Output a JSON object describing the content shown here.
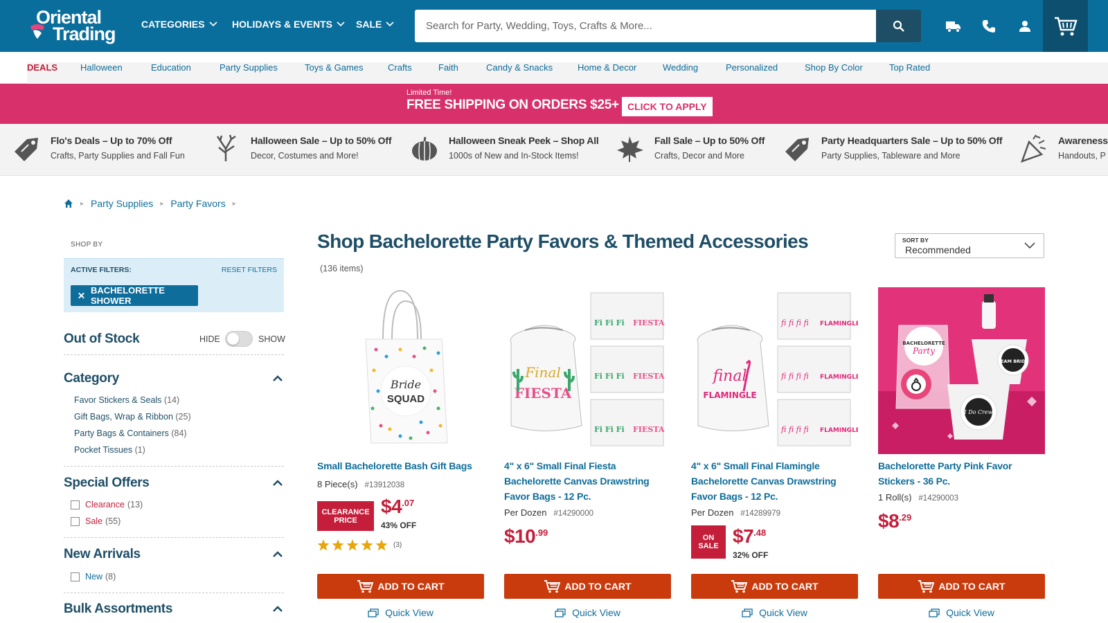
{
  "header": {
    "logo_line1": "Oriental",
    "logo_line2": "Trading",
    "nav": [
      "CATEGORIES",
      "HOLIDAYS & EVENTS",
      "SALE"
    ],
    "search_placeholder": "Search for Party, Wedding, Toys, Crafts & More...",
    "icons": [
      "truck-icon",
      "phone-icon",
      "account-icon",
      "cart-icon"
    ]
  },
  "catbar": [
    "DEALS",
    "Halloween",
    "Education",
    "Party Supplies",
    "Toys & Games",
    "Crafts",
    "Faith",
    "Candy & Snacks",
    "Home & Decor",
    "Wedding",
    "Personalized",
    "Shop By Color",
    "Top Rated"
  ],
  "promo": {
    "limited": "Limited Time!",
    "headline": "FREE SHIPPING ON ORDERS $25+",
    "apply": "CLICK TO APPLY"
  },
  "deals": [
    {
      "title": "Flo's Deals – Up to 70% Off",
      "sub": "Crafts, Party Supplies and Fall Fun",
      "icon": "tag-icon"
    },
    {
      "title": "Halloween Sale – Up to 50% Off",
      "sub": "Decor, Costumes and More!",
      "icon": "tree-icon"
    },
    {
      "title": "Halloween Sneak Peek – Shop All",
      "sub": "1000s of New and In-Stock Items!",
      "icon": "pumpkin-icon"
    },
    {
      "title": "Fall Sale – Up to 50% Off",
      "sub": "Crafts, Decor and More",
      "icon": "leaf-icon"
    },
    {
      "title": "Party Headquarters Sale – Up to 50% Off",
      "sub": "Party Supplies, Tableware and More",
      "icon": "tag-icon"
    },
    {
      "title": "Awareness & ",
      "sub": "Handouts, P",
      "icon": "confetti-icon"
    }
  ],
  "breadcrumb": [
    "Party Supplies",
    "Party Favors"
  ],
  "sidebar": {
    "shop_by": "SHOP BY",
    "active_filters": "ACTIVE FILTERS:",
    "reset": "RESET FILTERS",
    "chip": "BACHELORETTE SHOWER",
    "out_of_stock": "Out of Stock",
    "hide": "HIDE",
    "show": "SHOW",
    "category_title": "Category",
    "categories": [
      {
        "label": "Favor Stickers & Seals",
        "count": "(14)"
      },
      {
        "label": "Gift Bags, Wrap & Ribbon",
        "count": "(25)"
      },
      {
        "label": "Party Bags & Containers",
        "count": "(84)"
      },
      {
        "label": "Pocket Tissues",
        "count": "(1)"
      }
    ],
    "special_title": "Special Offers",
    "special": [
      {
        "label": "Clearance",
        "count": "(13)"
      },
      {
        "label": "Sale",
        "count": "(55)"
      }
    ],
    "new_title": "New Arrivals",
    "new": [
      {
        "label": "New",
        "count": "(8)"
      }
    ],
    "bulk_title": "Bulk Assortments"
  },
  "main": {
    "title": "Shop Bachelorette Party Favors & Themed Accessories",
    "count": "(136 items)",
    "sort_label": "SORT BY",
    "sort_value": "Recommended"
  },
  "products": [
    {
      "name": "Small Bachelorette Bash Gift Bags",
      "unit": "8 Piece(s)",
      "sku": "#13912038",
      "badge_line1": "CLEARANCE",
      "badge_line2": "PRICE",
      "price_d": "$4",
      "price_c": ".07",
      "off": "43% OFF",
      "rating": 5,
      "reviews": "(3)",
      "atc": "ADD TO CART",
      "qv": "Quick View",
      "img_text1": "Bride",
      "img_text2": "SQUAD"
    },
    {
      "name": "4\" x 6\" Small Final Fiesta Bachelorette Canvas Drawstring Favor Bags - 12 Pc.",
      "unit": "Per Dozen",
      "sku": "#14290000",
      "price_d": "$10",
      "price_c": ".99",
      "atc": "ADD TO CART",
      "qv": "Quick View",
      "img_text1": "Final",
      "img_text2": "FIESTA"
    },
    {
      "name": "4\" x 6\" Small Final Flamingle Bachelorette Canvas Drawstring Favor Bags - 12 Pc.",
      "unit": "Per Dozen",
      "sku": "#14289979",
      "badge_line1": "ON",
      "badge_line2": "SALE",
      "price_d": "$7",
      "price_c": ".48",
      "off": "32% OFF",
      "atc": "ADD TO CART",
      "qv": "Quick View",
      "img_text1": "final",
      "img_text2": "FLAMINGLE"
    },
    {
      "name": "Bachelorette Party Pink Favor Stickers - 36 Pc.",
      "unit": "1 Roll(s)",
      "sku": "#14290003",
      "price_d": "$8",
      "price_c": ".29",
      "atc": "ADD TO CART",
      "qv": "Quick View",
      "img_text1": "BACHELORETTE",
      "img_text2": "Party",
      "img_text3": "TEAM BRIDE",
      "img_text4": "I Do Crew"
    }
  ],
  "colors": {
    "brand_blue": "#0a6e9c",
    "dark_blue": "#1e4e66",
    "promo_pink": "#d8306a",
    "sale_red": "#c41e3a",
    "cart_orange": "#c93a0c",
    "star_gold": "#e9a60c"
  }
}
